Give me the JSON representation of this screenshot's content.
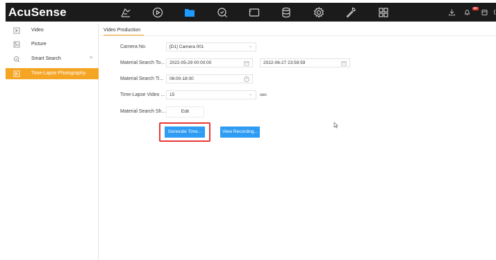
{
  "app": {
    "brand": "AcuSense"
  },
  "nav": {
    "icons": [
      "live-view-icon",
      "playback-icon",
      "folder-icon",
      "smart-search-icon",
      "display-icon",
      "storage-icon",
      "settings-icon",
      "maintenance-icon",
      "grid-icon"
    ],
    "active_icon": "folder-icon"
  },
  "top_right": {
    "icons": [
      "download-icon",
      "notification-icon",
      "user-icon"
    ],
    "badge": "99+"
  },
  "sidebar": {
    "items": [
      {
        "label": "Video",
        "icon": "video-file-icon"
      },
      {
        "label": "Picture",
        "icon": "picture-file-icon"
      },
      {
        "label": "Smart Search",
        "icon": "smart-search-icon",
        "chevron": ">"
      },
      {
        "label": "Time-Lapse Photography",
        "icon": "time-lapse-icon",
        "active": true
      }
    ]
  },
  "main": {
    "tab": "Video Production",
    "form": {
      "camera_label": "Camera No.",
      "camera_value": "[D1] Camera 001",
      "search_time_label": "Material Search To...",
      "search_start": "2022-05-29 00:00:00",
      "search_end": "2022-06-27 23:59:59",
      "search_time_interval_label": "Material Search Ti...",
      "time_interval_value": "06:00-18:00",
      "video_length_label": "Time-Lapse Video ...",
      "video_length_value": "15",
      "video_length_unit": "sec",
      "material_search_label": "Material Search Sh...",
      "edit_label": "Edit"
    },
    "buttons": {
      "generate": "Generate Time...",
      "view_recording": "View Recording..."
    }
  },
  "colors": {
    "accent": "#f5a524",
    "primary_button": "#2f9cf4",
    "highlight": "#e53935",
    "topbar": "#1b1b1b"
  }
}
